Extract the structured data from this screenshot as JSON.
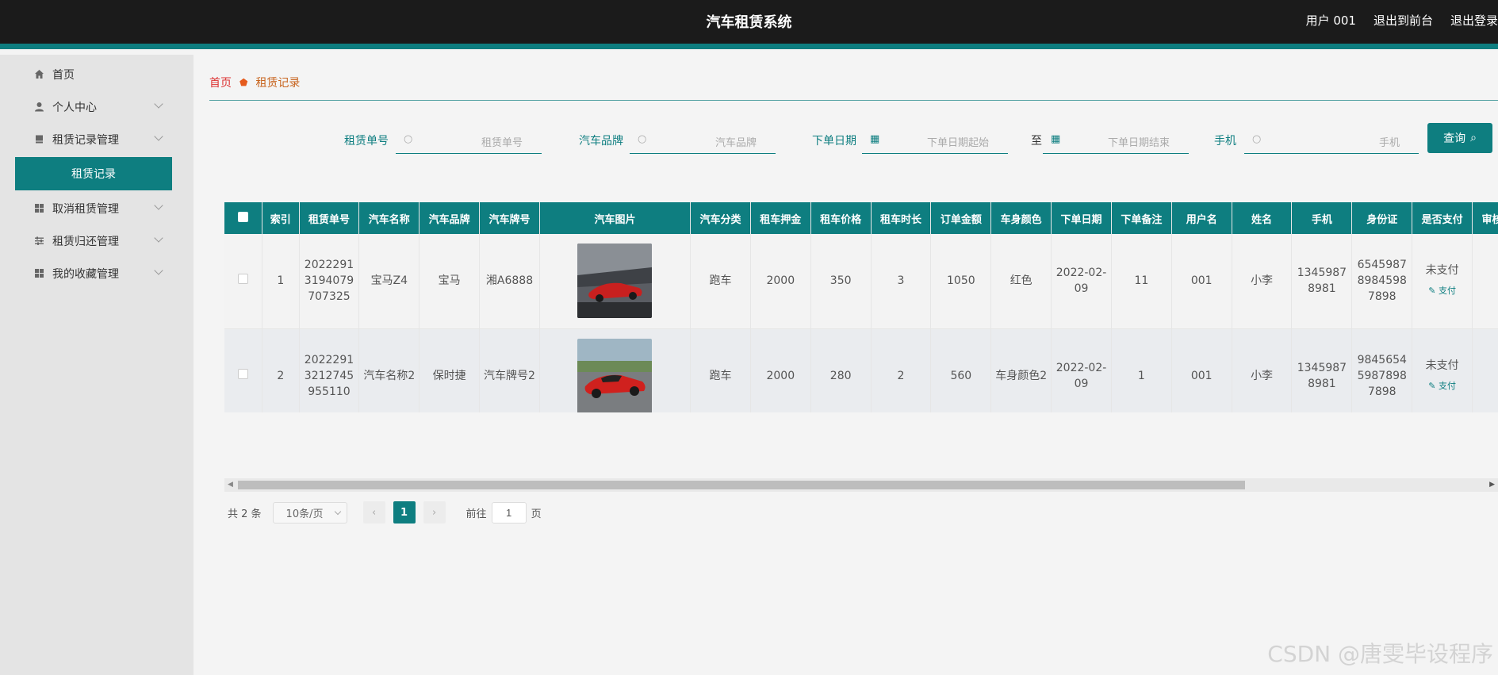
{
  "header": {
    "title": "汽车租赁系统",
    "user": "用户 001",
    "back_front": "退出到前台",
    "logout": "退出登录"
  },
  "sidebar": {
    "items": [
      {
        "label": "首页",
        "icon": "home-icon"
      },
      {
        "label": "个人中心",
        "icon": "user-icon"
      },
      {
        "label": "租赁记录管理",
        "icon": "document-icon"
      },
      {
        "label": "租赁记录",
        "sub": true
      },
      {
        "label": "取消租赁管理",
        "icon": "grid-icon"
      },
      {
        "label": "租赁归还管理",
        "icon": "sliders-icon"
      },
      {
        "label": "我的收藏管理",
        "icon": "grid-icon"
      }
    ]
  },
  "breadcrumb": {
    "home": "首页",
    "current": "租赁记录"
  },
  "search": {
    "order_label": "租赁单号",
    "order_ph": "租赁单号",
    "brand_label": "汽车品牌",
    "brand_ph": "汽车品牌",
    "date_label": "下单日期",
    "date_start_ph": "下单日期起始",
    "to": "至",
    "date_end_ph": "下单日期结束",
    "phone_label": "手机",
    "phone_ph": "手机",
    "query": "查询"
  },
  "table": {
    "columns": [
      "索引",
      "租赁单号",
      "汽车名称",
      "汽车品牌",
      "汽车牌号",
      "汽车图片",
      "汽车分类",
      "租车押金",
      "租车价格",
      "租车时长",
      "订单金额",
      "车身颜色",
      "下单日期",
      "下单备注",
      "用户名",
      "姓名",
      "手机",
      "身份证",
      "是否支付",
      "审核回复"
    ],
    "rows": [
      {
        "index": "1",
        "order_no": "20222913194079707325",
        "car_name": "宝马Z4",
        "brand": "宝马",
        "plate": "湘A6888",
        "category": "跑车",
        "deposit": "2000",
        "price": "350",
        "duration": "3",
        "amount": "1050",
        "color": "红色",
        "date": "2022-02-09",
        "remark": "11",
        "username": "001",
        "name": "小李",
        "phone": "13459878981",
        "id_card": "654598789845987898",
        "paid": "未支付",
        "pay_action": "支付"
      },
      {
        "index": "2",
        "order_no": "20222913212745955110",
        "car_name": "汽车名称2",
        "brand": "保时捷",
        "plate": "汽车牌号2",
        "category": "跑车",
        "deposit": "2000",
        "price": "280",
        "duration": "2",
        "amount": "560",
        "color": "车身颜色2",
        "date": "2022-02-09",
        "remark": "1",
        "username": "001",
        "name": "小李",
        "phone": "13459878981",
        "id_card": "984565459878987898",
        "paid": "未支付",
        "pay_action": "支付"
      }
    ]
  },
  "pagination": {
    "total": "共 2 条",
    "page_size": "10条/页",
    "current": "1",
    "goto": "前往",
    "goto_value": "1",
    "unit": "页"
  },
  "watermark": "CSDN @唐雯毕设程序",
  "colors": {
    "accent": "#0e7e80",
    "header_bg": "#1b1b1b",
    "sidebar_bg": "#e4e4e4"
  }
}
